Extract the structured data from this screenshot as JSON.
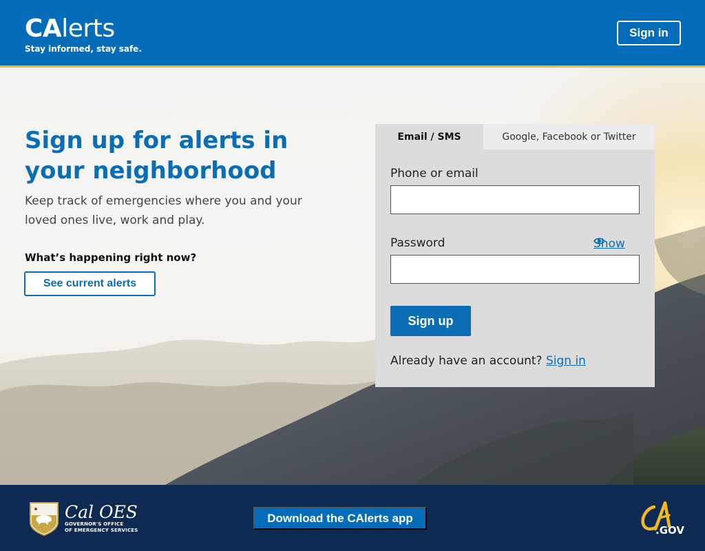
{
  "header": {
    "brand_ca": "CA",
    "brand_rest": "lerts",
    "tagline": "Stay informed, stay safe.",
    "signin_label": "Sign in"
  },
  "hero": {
    "title": "Sign up for alerts in your neighborhood",
    "subtitle": "Keep track of emergencies where you and your loved ones live, work and play.",
    "happening_label": "What’s happening right now?",
    "see_alerts_label": "See current alerts"
  },
  "form": {
    "tabs": [
      {
        "label": "Email / SMS",
        "active": true
      },
      {
        "label": "Google, Facebook or Twitter",
        "active": false
      }
    ],
    "phone_label": "Phone or email",
    "phone_value": "",
    "password_label": "Password",
    "password_value": "",
    "show_label": "Show",
    "signup_label": "Sign up",
    "already_text": "Already have an account?",
    "signin_link": "Sign in"
  },
  "footer": {
    "caloes_name": "Cal OES",
    "caloes_sub_1": "GOVERNOR'S OFFICE",
    "caloes_sub_2": "OF EMERGENCY SERVICES",
    "download_label": "Download the CAlerts app",
    "cagov_label": ".GOV"
  },
  "colors": {
    "primary": "#046cb8",
    "accent_stripe": "#f1b826",
    "footer_bg": "#0e2a52",
    "card_bg": "#dcdcdc"
  },
  "icons": [
    "eye-icon",
    "caloes-seal-icon",
    "ca-gov-logo"
  ]
}
